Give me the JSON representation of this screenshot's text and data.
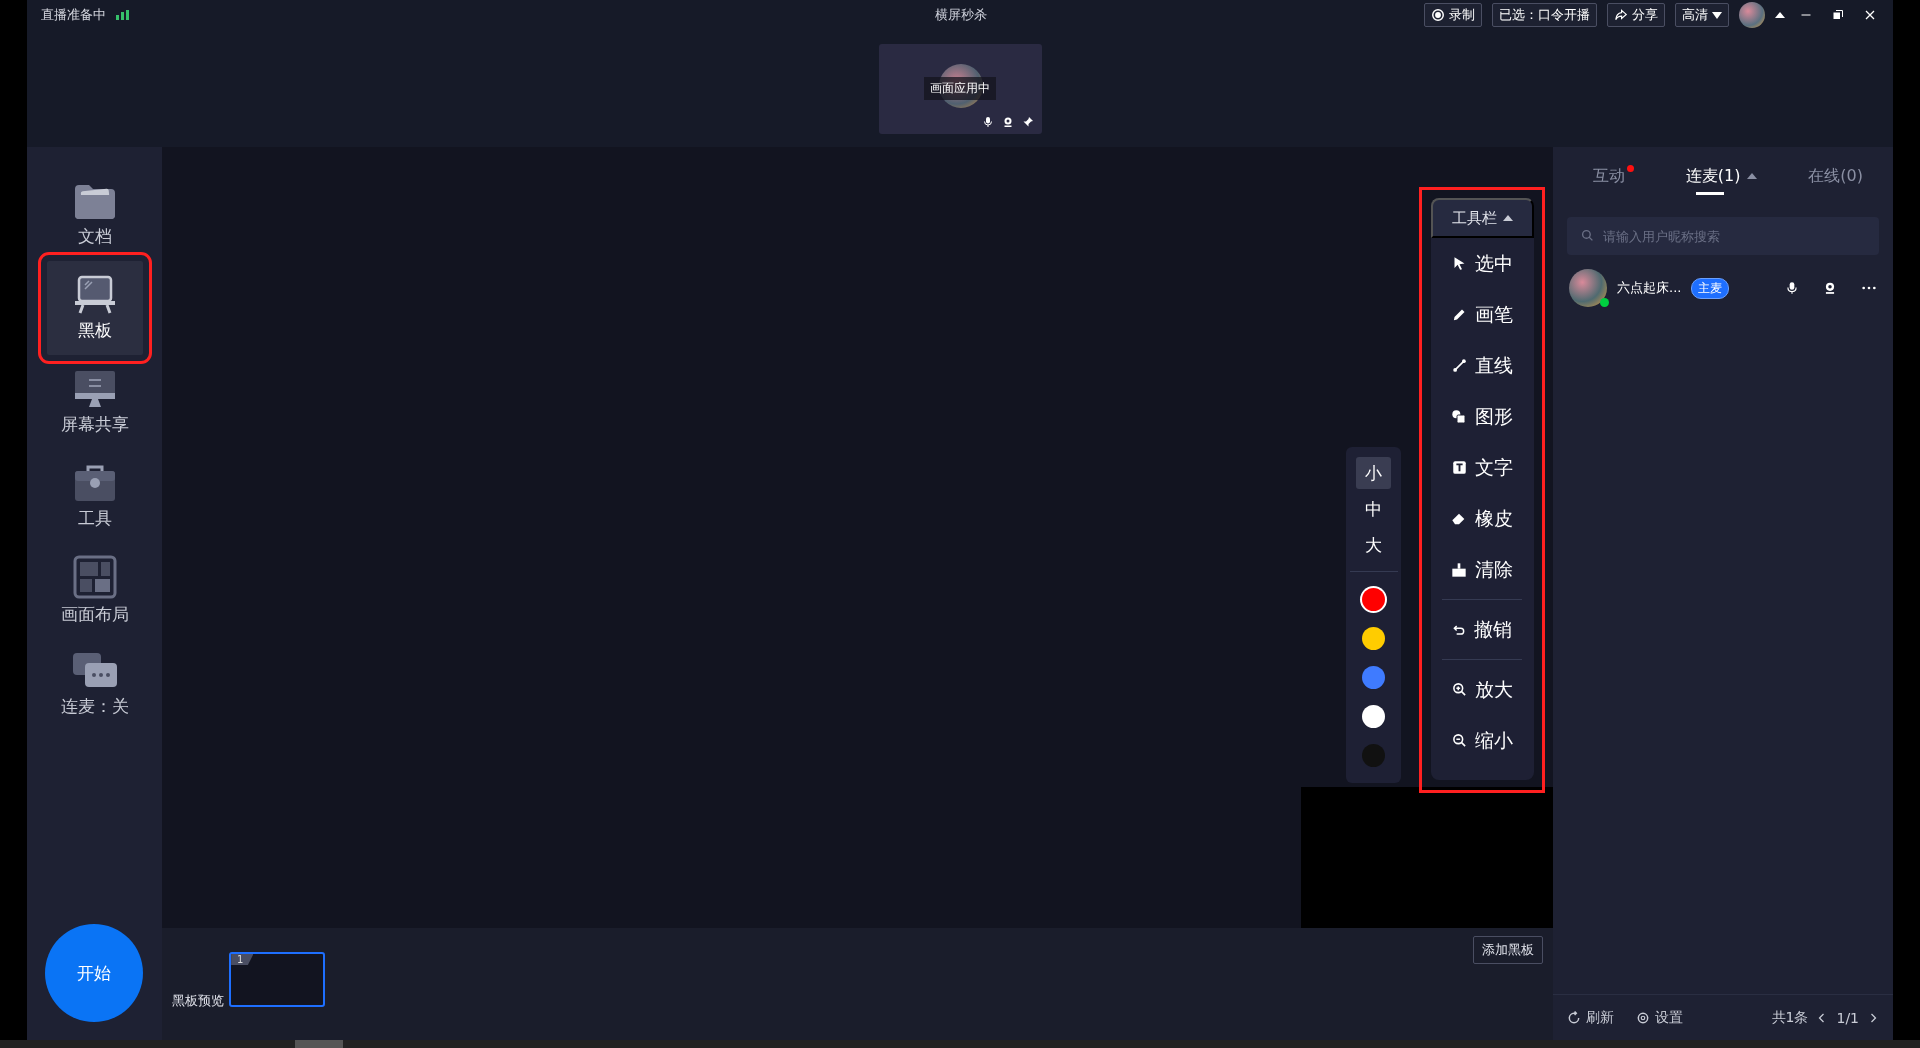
{
  "top_bar": {
    "status": "直播准备中",
    "title": "横屏秒杀",
    "buttons": [
      {
        "kind": "record",
        "label": "录制"
      },
      {
        "kind": "plain",
        "label": "已选：口令开播"
      },
      {
        "kind": "share",
        "label": "分享"
      },
      {
        "kind": "dropdown",
        "label": "高清"
      }
    ]
  },
  "preview_card": {
    "label": "画面应用中"
  },
  "sidebar": {
    "items": [
      {
        "kind": "folder",
        "label": "文档",
        "selected": false
      },
      {
        "kind": "board",
        "label": "黑板",
        "selected": true
      },
      {
        "kind": "screen",
        "label": "屏幕共享",
        "selected": false
      },
      {
        "kind": "toolbox",
        "label": "工具",
        "selected": false
      },
      {
        "kind": "layout",
        "label": "画面布局",
        "selected": false
      },
      {
        "kind": "chat",
        "label": "连麦：关",
        "selected": false
      }
    ],
    "start_button": "开始"
  },
  "toolbar": {
    "header": "工具栏",
    "items": [
      {
        "kind": "select",
        "label": "选中"
      },
      {
        "kind": "pen",
        "label": "画笔"
      },
      {
        "kind": "line",
        "label": "直线"
      },
      {
        "kind": "shape",
        "label": "图形"
      },
      {
        "kind": "text",
        "label": "文字"
      },
      {
        "kind": "eraser",
        "label": "橡皮"
      },
      {
        "kind": "clear",
        "label": "清除"
      },
      {
        "kind": "divider"
      },
      {
        "kind": "undo",
        "label": "撤销"
      },
      {
        "kind": "divider"
      },
      {
        "kind": "zoom_in",
        "label": "放大"
      },
      {
        "kind": "zoom_out",
        "label": "缩小"
      }
    ]
  },
  "pen_options": {
    "sizes": [
      {
        "label": "小",
        "selected": true
      },
      {
        "label": "中",
        "selected": false
      },
      {
        "label": "大",
        "selected": false
      }
    ],
    "colors": [
      {
        "color": "#ff0000",
        "selected": true
      },
      {
        "color": "#ffcc00",
        "selected": false
      },
      {
        "color": "#3f7bff",
        "selected": false
      },
      {
        "color": "#ffffff",
        "selected": false
      },
      {
        "color": "#111111",
        "selected": false
      }
    ]
  },
  "board_preview": {
    "title": "黑板预览",
    "add_button": "添加黑板",
    "pages": [
      {
        "number": "1",
        "selected": true
      }
    ]
  },
  "right_panel": {
    "tabs": [
      {
        "label": "互动",
        "selected": false,
        "unread": true
      },
      {
        "label": "连麦(1)",
        "selected": true,
        "unread": false
      },
      {
        "label": "在线(0)",
        "selected": false,
        "unread": false
      }
    ],
    "search": {
      "placeholder": "请输入用户昵称搜索"
    },
    "users": [
      {
        "name": "六点起床...",
        "badge": "主麦",
        "online": true
      }
    ],
    "footer": {
      "refresh": "刷新",
      "settings": "设置",
      "count": "共1条",
      "page": "1/1"
    }
  }
}
